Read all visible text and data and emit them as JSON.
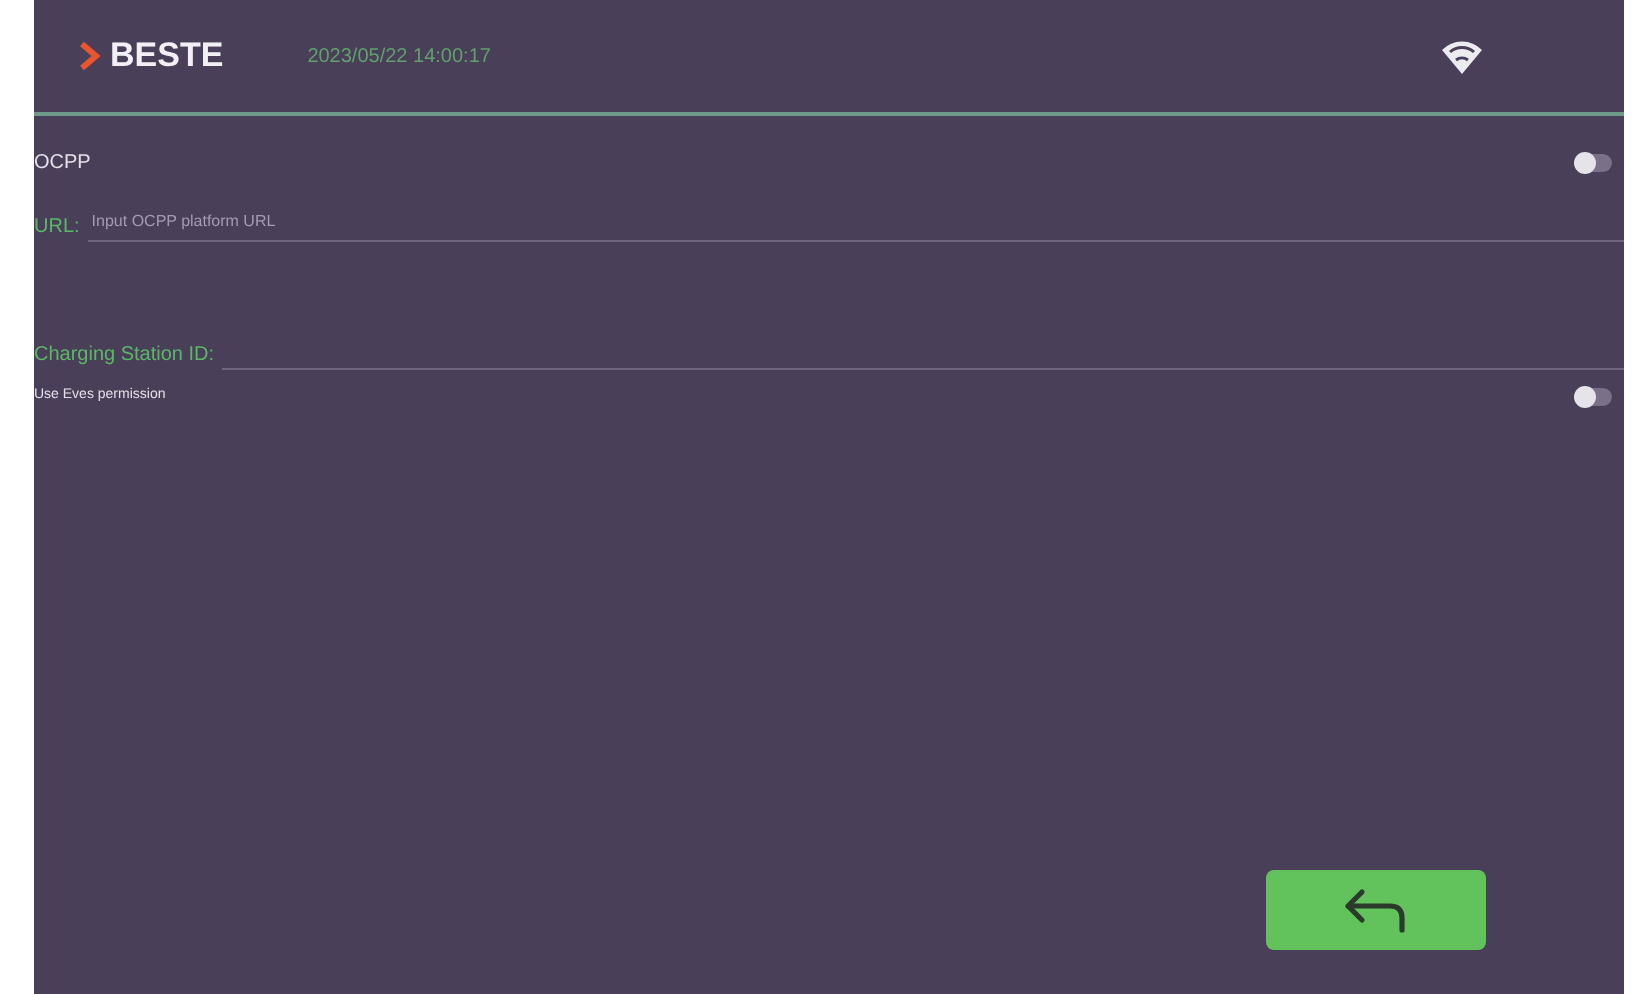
{
  "header": {
    "logo": "BESTE",
    "datetime": "2023/05/22 14:00:17"
  },
  "settings": [
    {
      "kind": "toggle",
      "label": "OCPP",
      "on": false
    },
    {
      "kind": "field",
      "label": "URL:",
      "placeholder": "Input OCPP platform URL"
    },
    {
      "kind": "field",
      "label": "Charging Station ID:"
    },
    {
      "kind": "toggle",
      "label": "Use Eves permission",
      "small": true,
      "on": false
    }
  ]
}
